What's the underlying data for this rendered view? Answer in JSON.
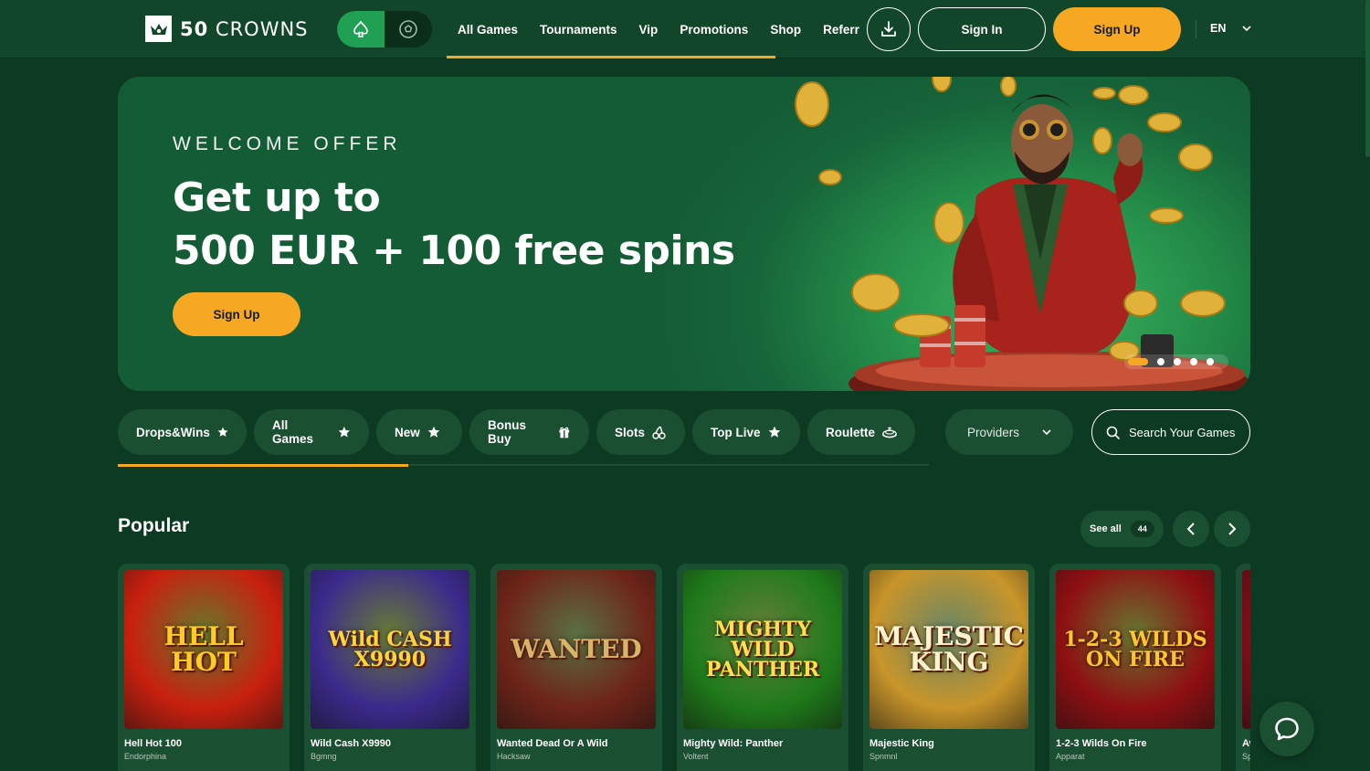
{
  "header": {
    "logo_number": "50",
    "logo_word": "CROWNS",
    "nav": [
      "All Games",
      "Tournaments",
      "Vip",
      "Promotions",
      "Shop",
      "Referral"
    ],
    "signin_label": "Sign In",
    "signup_label": "Sign Up",
    "language": "EN"
  },
  "hero": {
    "kicker": "WELCOME OFFER",
    "title_line1": "Get up to",
    "title_line2": "500 EUR + 100 free spins",
    "cta_label": "Sign Up",
    "slides": 5,
    "active_slide": 1
  },
  "categories": [
    {
      "label": "Drops&Wins",
      "icon": "star-icon"
    },
    {
      "label": "All Games",
      "icon": "star-icon"
    },
    {
      "label": "New",
      "icon": "star-icon"
    },
    {
      "label": "Bonus Buy",
      "icon": "gift-icon"
    },
    {
      "label": "Slots",
      "icon": "cherry-icon"
    },
    {
      "label": "Top Live",
      "icon": "star-icon"
    },
    {
      "label": "Roulette",
      "icon": "roulette-icon"
    }
  ],
  "providers_label": "Providers",
  "search_placeholder": "Search Your Games",
  "popular": {
    "title": "Popular",
    "see_all_label": "See all",
    "count": "44",
    "games": [
      {
        "title": "Hell Hot 100",
        "provider": "Endorphina",
        "art": "HELL HOT",
        "bg": "#c8200f",
        "fg": "#ffcc21"
      },
      {
        "title": "Wild Cash X9990",
        "provider": "Bgmng",
        "art": "Wild CASH X9990",
        "bg": "#3b2a8c",
        "fg": "#ffd43b"
      },
      {
        "title": "Wanted Dead Or A Wild",
        "provider": "Hacksaw",
        "art": "WANTED",
        "bg": "#6e2418",
        "fg": "#d8b46a"
      },
      {
        "title": "Mighty Wild: Panther",
        "provider": "Voltent",
        "art": "MIGHTY WILD PANTHER",
        "bg": "#1f7a1a",
        "fg": "#ffdf4d"
      },
      {
        "title": "Majestic King",
        "provider": "Spnmnl",
        "art": "MAJESTIC KING",
        "bg": "#c9952a",
        "fg": "#fff3d0"
      },
      {
        "title": "1-2-3 Wilds On Fire",
        "provider": "Apparat",
        "art": "1-2-3 WILDS ON FIRE",
        "bg": "#8e0f12",
        "fg": "#ffc52e"
      },
      {
        "title": "Aviator",
        "provider": "Spribe",
        "art": "",
        "bg": "#7d0d18",
        "fg": "#ffffff"
      }
    ]
  },
  "colors": {
    "accent": "#f7a823",
    "background": "#0d3a22",
    "panel": "#1a4f31"
  }
}
